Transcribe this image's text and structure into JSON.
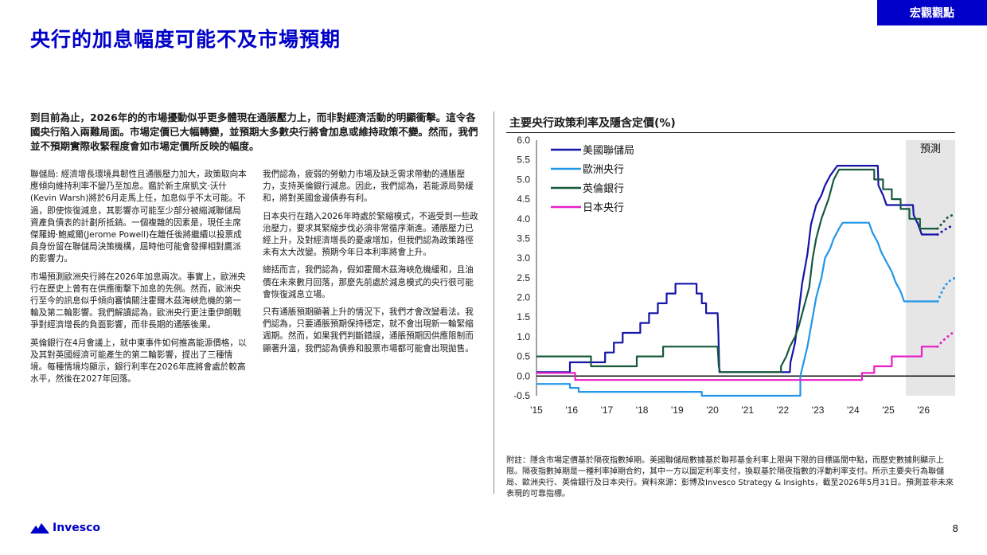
{
  "header": {
    "tag": "宏觀觀點",
    "title": "央行的加息幅度可能不及市場預期"
  },
  "lead": "到目前為止，2026年的的市場擾動似乎更多體現在通脹壓力上，而非對經濟活動的明顯衝擊。這令各國央行陷入兩難局面。市場定價已大幅轉變，並預期大多數央行將會加息或維持政策不變。然而，我們並不預期實際收緊程度會如市場定價所反映的幅度。",
  "col1": {
    "p1": "聯儲局: 經濟增長環境具韌性且通脹壓力加大，政策取向本應傾向維持利率不變乃至加息。鑑於新主席凱文·沃什(Kevin Warsh)將於6月走馬上任，加息似乎不太可能。不過，即使恢復減息，其影響亦可能至少部分被縮減聯儲局資產負債表的計劃所抵銷。一個複雜的因素是，現任主席傑羅姆·鮑威爾(Jerome Powell)在離任後將繼續以投票成員身份留在聯儲局決策機構，屆時他可能會發揮相對鷹派的影響力。",
    "p2": "市場預測歐洲央行將在2026年加息兩次。事實上，歐洲央行在歷史上曾有在供應衝擊下加息的先例。然而，歐洲央行至今的訊息似乎傾向審慎關注霍爾木茲海峽危機的第一輪及第二輪影響。我們解讀認為，歐洲央行更注重伊朗戰爭對經濟增長的負面影響，而非長期的通脹後果。",
    "p3": "英倫銀行在4月會議上，就中東事件如何推高能源價格，以及其對英國經濟可能產生的第二輪影響，提出了三種情境。每種情境均顯示，銀行利率在2026年底將會處於較高水平，然後在2027年回落。"
  },
  "col2": {
    "p1": "我們認為，疲弱的勞動力市場及缺乏需求帶動的通脹壓力，支持英倫銀行減息。因此，我們認為，若能源局勢緩和，將對英國金邊債券有利。",
    "p2": "日本央行在踏入2026年時處於緊縮模式，不過受到一些政治壓力，要求其緊縮步伐必須非常循序漸進。通脹壓力已經上升，及對經濟增長的憂慮增加，但我們認為政策路徑未有太大改變。預期今年日本利率將會上升。",
    "p3": "總括而言，我們認為，假如霍爾木茲海峽危機緩和，且油價在未來數月回落，那麼先前處於減息模式的央行很可能會恢復減息立場。",
    "p4": "只有通脹預期顯著上升的情況下，我們才會改變看法。我們認為，只要通脹預期保持穩定，就不會出現新一輪緊縮週期。然而，如果我們判斷錯誤，通脹預期因供應限制而顯著升溫，我們認為債券和股票市場都可能會出現拋售。"
  },
  "chart_data": {
    "type": "line",
    "title": "主要央行政策利率及隱含定價(%)",
    "forecast_label": "預測",
    "ylim": [
      -0.5,
      6.0
    ],
    "yticks": [
      "6.0",
      "5.5",
      "5.0",
      "4.5",
      "4.0",
      "3.5",
      "3.0",
      "2.5",
      "2.0",
      "1.5",
      "1.0",
      "0.5",
      "0.0",
      "-0.5"
    ],
    "xlim": [
      2015.0,
      2026.9
    ],
    "xticks": [
      {
        "label": "'15",
        "v": 2015
      },
      {
        "label": "'16",
        "v": 2016
      },
      {
        "label": "'17",
        "v": 2017
      },
      {
        "label": "'18",
        "v": 2018
      },
      {
        "label": "'19",
        "v": 2019
      },
      {
        "label": "'20",
        "v": 2020
      },
      {
        "label": "'21",
        "v": 2021
      },
      {
        "label": "'22",
        "v": 2022
      },
      {
        "label": "'23",
        "v": 2023
      },
      {
        "label": "'24",
        "v": 2024
      },
      {
        "label": "'25",
        "v": 2025
      },
      {
        "label": "'26",
        "v": 2026
      }
    ],
    "forecast_start": 2025.5,
    "series": [
      {
        "name": "美國聯儲局",
        "color": "#1414a8",
        "points": [
          [
            2015.0,
            0.1
          ],
          [
            2015.95,
            0.1
          ],
          [
            2015.95,
            0.35
          ],
          [
            2016.95,
            0.35
          ],
          [
            2016.95,
            0.6
          ],
          [
            2017.2,
            0.6
          ],
          [
            2017.2,
            0.85
          ],
          [
            2017.45,
            0.85
          ],
          [
            2017.45,
            1.1
          ],
          [
            2017.95,
            1.1
          ],
          [
            2017.95,
            1.35
          ],
          [
            2018.2,
            1.35
          ],
          [
            2018.2,
            1.6
          ],
          [
            2018.45,
            1.6
          ],
          [
            2018.45,
            1.85
          ],
          [
            2018.7,
            1.85
          ],
          [
            2018.7,
            2.1
          ],
          [
            2018.95,
            2.1
          ],
          [
            2018.95,
            2.35
          ],
          [
            2019.55,
            2.35
          ],
          [
            2019.55,
            2.1
          ],
          [
            2019.7,
            2.1
          ],
          [
            2019.7,
            1.85
          ],
          [
            2019.82,
            1.85
          ],
          [
            2019.82,
            1.6
          ],
          [
            2020.15,
            1.6
          ],
          [
            2020.17,
            1.1
          ],
          [
            2020.2,
            0.1
          ],
          [
            2022.2,
            0.1
          ],
          [
            2022.22,
            0.35
          ],
          [
            2022.35,
            0.85
          ],
          [
            2022.45,
            1.6
          ],
          [
            2022.55,
            2.35
          ],
          [
            2022.7,
            3.1
          ],
          [
            2022.8,
            3.85
          ],
          [
            2022.95,
            4.35
          ],
          [
            2023.1,
            4.6
          ],
          [
            2023.2,
            4.85
          ],
          [
            2023.35,
            5.1
          ],
          [
            2023.55,
            5.35
          ],
          [
            2024.7,
            5.35
          ],
          [
            2024.72,
            4.85
          ],
          [
            2024.85,
            4.6
          ],
          [
            2024.95,
            4.35
          ],
          [
            2025.7,
            4.35
          ],
          [
            2025.72,
            4.1
          ],
          [
            2025.85,
            3.85
          ],
          [
            2025.95,
            3.6
          ],
          [
            2026.4,
            3.6
          ]
        ],
        "forecast": [
          [
            2026.4,
            3.6
          ],
          [
            2026.6,
            3.72
          ],
          [
            2026.8,
            3.82
          ]
        ]
      },
      {
        "name": "歐洲央行",
        "color": "#2196e8",
        "points": [
          [
            2015.0,
            -0.2
          ],
          [
            2015.95,
            -0.2
          ],
          [
            2015.95,
            -0.3
          ],
          [
            2016.2,
            -0.3
          ],
          [
            2016.2,
            -0.4
          ],
          [
            2019.7,
            -0.4
          ],
          [
            2019.7,
            -0.5
          ],
          [
            2022.5,
            -0.5
          ],
          [
            2022.5,
            0.0
          ],
          [
            2022.7,
            0.75
          ],
          [
            2022.85,
            1.5
          ],
          [
            2022.95,
            2.0
          ],
          [
            2023.1,
            2.5
          ],
          [
            2023.2,
            3.0
          ],
          [
            2023.35,
            3.25
          ],
          [
            2023.45,
            3.5
          ],
          [
            2023.6,
            3.75
          ],
          [
            2023.7,
            3.9
          ],
          [
            2024.45,
            3.9
          ],
          [
            2024.55,
            3.65
          ],
          [
            2024.7,
            3.4
          ],
          [
            2024.8,
            3.15
          ],
          [
            2024.95,
            2.9
          ],
          [
            2025.1,
            2.65
          ],
          [
            2025.2,
            2.4
          ],
          [
            2025.35,
            2.15
          ],
          [
            2025.45,
            1.9
          ],
          [
            2026.4,
            1.9
          ]
        ],
        "forecast": [
          [
            2026.4,
            1.9
          ],
          [
            2026.55,
            2.2
          ],
          [
            2026.7,
            2.4
          ],
          [
            2026.9,
            2.5
          ]
        ]
      },
      {
        "name": "英倫銀行",
        "color": "#17593a",
        "points": [
          [
            2015.0,
            0.5
          ],
          [
            2016.55,
            0.5
          ],
          [
            2016.55,
            0.25
          ],
          [
            2017.85,
            0.25
          ],
          [
            2017.85,
            0.5
          ],
          [
            2018.6,
            0.5
          ],
          [
            2018.6,
            0.75
          ],
          [
            2020.15,
            0.75
          ],
          [
            2020.18,
            0.25
          ],
          [
            2020.22,
            0.1
          ],
          [
            2021.95,
            0.1
          ],
          [
            2021.95,
            0.25
          ],
          [
            2022.1,
            0.5
          ],
          [
            2022.2,
            0.75
          ],
          [
            2022.35,
            1.0
          ],
          [
            2022.45,
            1.25
          ],
          [
            2022.6,
            1.75
          ],
          [
            2022.75,
            2.25
          ],
          [
            2022.85,
            3.0
          ],
          [
            2022.95,
            3.5
          ],
          [
            2023.1,
            4.0
          ],
          [
            2023.3,
            4.5
          ],
          [
            2023.45,
            5.0
          ],
          [
            2023.6,
            5.25
          ],
          [
            2024.6,
            5.25
          ],
          [
            2024.6,
            5.0
          ],
          [
            2024.85,
            5.0
          ],
          [
            2024.85,
            4.75
          ],
          [
            2025.1,
            4.75
          ],
          [
            2025.1,
            4.5
          ],
          [
            2025.35,
            4.5
          ],
          [
            2025.35,
            4.25
          ],
          [
            2025.6,
            4.25
          ],
          [
            2025.6,
            4.0
          ],
          [
            2025.9,
            4.0
          ],
          [
            2025.9,
            3.75
          ],
          [
            2026.4,
            3.75
          ]
        ],
        "forecast": [
          [
            2026.4,
            3.75
          ],
          [
            2026.55,
            3.9
          ],
          [
            2026.7,
            4.05
          ],
          [
            2026.9,
            4.12
          ]
        ]
      },
      {
        "name": "日本央行",
        "color": "#e81ec8",
        "points": [
          [
            2015.0,
            0.08
          ],
          [
            2016.1,
            0.08
          ],
          [
            2016.1,
            -0.1
          ],
          [
            2024.25,
            -0.1
          ],
          [
            2024.25,
            0.08
          ],
          [
            2024.6,
            0.08
          ],
          [
            2024.6,
            0.25
          ],
          [
            2025.1,
            0.25
          ],
          [
            2025.1,
            0.5
          ],
          [
            2025.95,
            0.5
          ],
          [
            2025.95,
            0.75
          ],
          [
            2026.4,
            0.75
          ]
        ],
        "forecast": [
          [
            2026.4,
            0.75
          ],
          [
            2026.55,
            0.9
          ],
          [
            2026.75,
            1.05
          ],
          [
            2026.9,
            1.15
          ]
        ]
      }
    ]
  },
  "footnote": "附註：隱含市場定價基於隔夜指數掉期。美國聯儲局數據基於聯邦基金利率上限與下限的目標區間中點，而歷史數據則顯示上限。隔夜指數掉期是一種利率掉期合約，其中一方以固定利率支付，換取基於隔夜指數的浮動利率支付。所示主要央行為聯儲局、歐洲央行、英倫銀行及日本央行。資料來源：彭博及Invesco Strategy & Insights，截至2026年5月31日。預測並非未來表現的可靠指標。",
  "footer": {
    "logo": "Invesco",
    "page": "8"
  }
}
